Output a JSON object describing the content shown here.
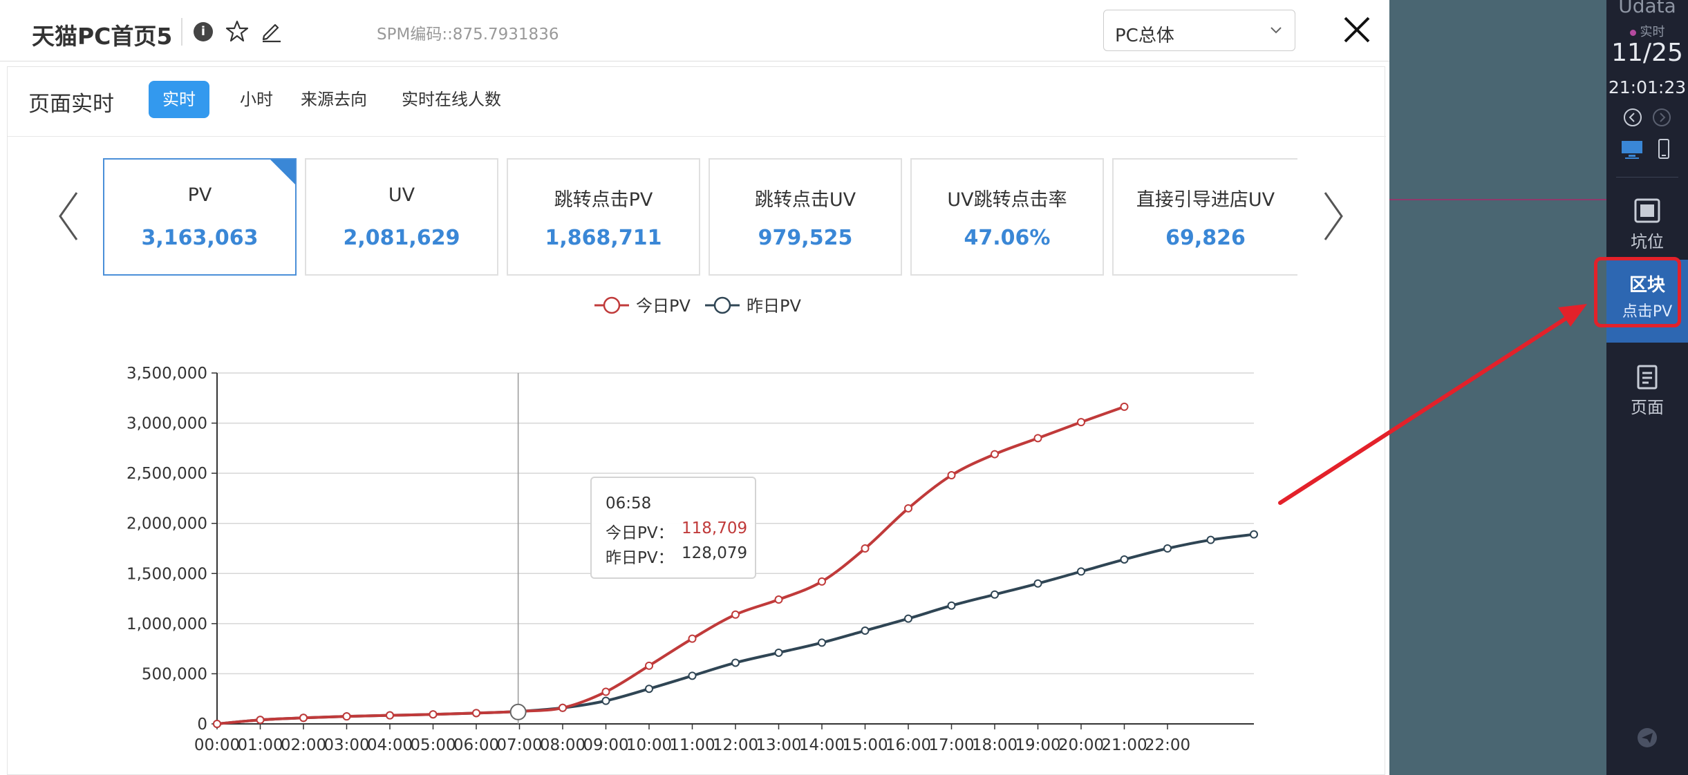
{
  "modal": {
    "title": "天猫PC首页5",
    "info_glyph": "i",
    "spm": "SPM编码::875.7931836",
    "select_value": "PC总体"
  },
  "section": {
    "title": "页面实时",
    "tabs": [
      {
        "label": "实时",
        "active": true
      },
      {
        "label": "小时",
        "active": false
      },
      {
        "label": "来源去向",
        "active": false
      },
      {
        "label": "实时在线人数",
        "active": false
      }
    ]
  },
  "kpis": [
    {
      "label": "PV",
      "value": "3,163,063",
      "active": true
    },
    {
      "label": "UV",
      "value": "2,081,629",
      "active": false
    },
    {
      "label": "跳转点击PV",
      "value": "1,868,711",
      "active": false
    },
    {
      "label": "跳转点击UV",
      "value": "979,525",
      "active": false
    },
    {
      "label": "UV跳转点击率",
      "value": "47.06%",
      "active": false
    },
    {
      "label": "直接引导进店UV",
      "value": "69,826",
      "active": false
    }
  ],
  "tooltip": {
    "time": "06:58",
    "today_label": "今日PV：",
    "today_value": "118,709",
    "yesterday_label": "昨日PV：",
    "yesterday_value": "128,079"
  },
  "chart_data": {
    "type": "line",
    "categories": [
      "00:00",
      "01:00",
      "02:00",
      "03:00",
      "04:00",
      "05:00",
      "06:00",
      "07:00",
      "08:00",
      "09:00",
      "10:00",
      "11:00",
      "12:00",
      "13:00",
      "14:00",
      "15:00",
      "16:00",
      "17:00",
      "18:00",
      "19:00",
      "20:00",
      "21:00",
      "22:00"
    ],
    "ylim": [
      0,
      3500000
    ],
    "yticks": [
      0,
      500000,
      1000000,
      1500000,
      2000000,
      2500000,
      3000000,
      3500000
    ],
    "ytick_labels": [
      "0",
      "500,000",
      "1,000,000",
      "1,500,000",
      "2,000,000",
      "2,500,000",
      "3,000,000",
      "3,500,000"
    ],
    "xtick_labels": [
      "00:00",
      "01:00",
      "02:00",
      "03:00",
      "04:00",
      "05:00",
      "06:00",
      "07:00",
      "08:00",
      "09:00",
      "10:00",
      "11:00",
      "12:00",
      "13:00",
      "14:00",
      "15:00",
      "16:00",
      "17:00",
      "18:00",
      "19:00",
      "20:00",
      "21:00",
      "22:00"
    ],
    "legend": "top",
    "grid": true,
    "series": [
      {
        "name": "今日PV",
        "color": "#c03a3a",
        "values": [
          0,
          40000,
          60000,
          75000,
          85000,
          95000,
          108000,
          125000,
          160000,
          320000,
          580000,
          850000,
          1090000,
          1240000,
          1420000,
          1750000,
          2150000,
          2480000,
          2690000,
          2850000,
          3010000,
          3163063
        ]
      },
      {
        "name": "昨日PV",
        "color": "#2f4554",
        "values": [
          0,
          40000,
          60000,
          75000,
          85000,
          95000,
          108000,
          125000,
          160000,
          230000,
          350000,
          480000,
          610000,
          710000,
          810000,
          930000,
          1050000,
          1180000,
          1290000,
          1400000,
          1520000,
          1640000,
          1750000,
          1835000,
          1890000
        ]
      }
    ],
    "hover": {
      "x_hours": 6.97
    }
  },
  "sidebar": {
    "brand": "Udata",
    "live_label": "实时",
    "date": "11/25",
    "time": "21:01:23",
    "items": [
      {
        "label": "坑位",
        "icon": "slot-icon"
      },
      {
        "label_main": "区块",
        "label_sub": "点击PV",
        "icon": "block-icon",
        "active": true
      },
      {
        "label": "页面",
        "icon": "page-icon"
      }
    ]
  },
  "colors": {
    "accent": "#3399ee",
    "kpi_value": "#3a87d6",
    "today": "#c03a3a",
    "yesterday": "#2f4554",
    "annotation": "#e3212a"
  }
}
